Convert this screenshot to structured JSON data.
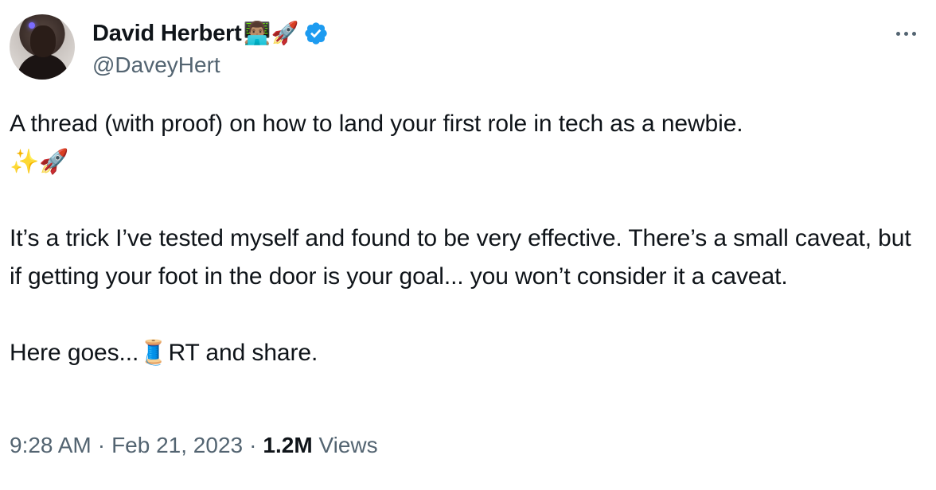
{
  "tweet": {
    "author": {
      "display_name": "David Herbert",
      "name_emojis": "👨🏽‍💻🚀",
      "handle": "@DaveyHert",
      "verified": true,
      "avatar": "profile-photo"
    },
    "more_icon": "more-horizontal-icon",
    "body": {
      "line1": "A thread (with proof) on how to land your first role in tech as a newbie.",
      "line2": "✨🚀",
      "para2": "It’s a trick I’ve tested myself and found to be very effective. There’s a small caveat, but if getting your foot in the door is your goal... you won’t consider it a caveat.",
      "para3_pre": "Here goes...",
      "para3_emoji": "🧵",
      "para3_post": "RT and share."
    },
    "time": "9:28 AM",
    "separator": "·",
    "date": "Feb 21, 2023",
    "views_count": "1.2M",
    "views_label": "Views"
  },
  "colors": {
    "text": "#0f1419",
    "secondary": "#536471",
    "verified": "#1d9bf0"
  }
}
